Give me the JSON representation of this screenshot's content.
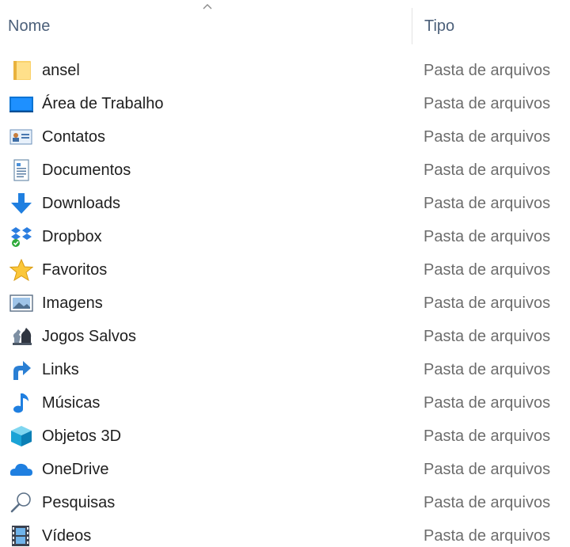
{
  "columns": {
    "name": "Nome",
    "type": "Tipo"
  },
  "sort": {
    "column": "name",
    "direction": "ascending",
    "icon": "chevron-up-icon"
  },
  "items": [
    {
      "name": "ansel",
      "type": "Pasta de arquivos",
      "icon": "folder-icon"
    },
    {
      "name": "Área de Trabalho",
      "type": "Pasta de arquivos",
      "icon": "desktop-icon"
    },
    {
      "name": "Contatos",
      "type": "Pasta de arquivos",
      "icon": "contacts-icon"
    },
    {
      "name": "Documentos",
      "type": "Pasta de arquivos",
      "icon": "document-icon"
    },
    {
      "name": "Downloads",
      "type": "Pasta de arquivos",
      "icon": "download-arrow-icon"
    },
    {
      "name": "Dropbox",
      "type": "Pasta de arquivos",
      "icon": "dropbox-icon"
    },
    {
      "name": "Favoritos",
      "type": "Pasta de arquivos",
      "icon": "star-icon"
    },
    {
      "name": "Imagens",
      "type": "Pasta de arquivos",
      "icon": "image-icon"
    },
    {
      "name": "Jogos Salvos",
      "type": "Pasta de arquivos",
      "icon": "chess-piece-icon"
    },
    {
      "name": "Links",
      "type": "Pasta de arquivos",
      "icon": "link-arrow-icon"
    },
    {
      "name": "Músicas",
      "type": "Pasta de arquivos",
      "icon": "music-note-icon"
    },
    {
      "name": "Objetos 3D",
      "type": "Pasta de arquivos",
      "icon": "cube-3d-icon"
    },
    {
      "name": "OneDrive",
      "type": "Pasta de arquivos",
      "icon": "cloud-icon"
    },
    {
      "name": "Pesquisas",
      "type": "Pasta de arquivos",
      "icon": "search-icon"
    },
    {
      "name": "Vídeos",
      "type": "Pasta de arquivos",
      "icon": "film-icon"
    }
  ]
}
